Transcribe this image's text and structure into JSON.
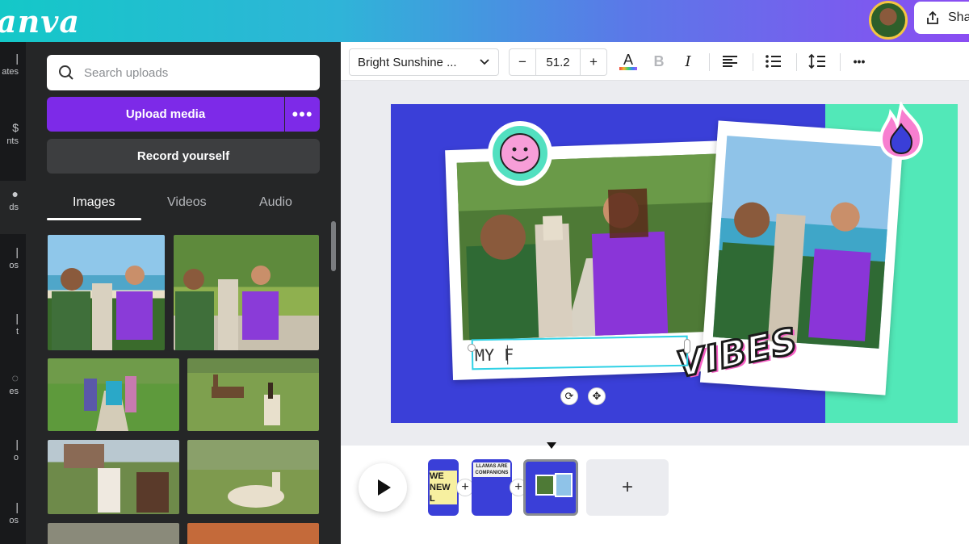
{
  "header": {
    "logo": "anva",
    "share_label": "Sha"
  },
  "rail": {
    "items": [
      {
        "label": "ates",
        "icon": "templates-icon"
      },
      {
        "label": "nts",
        "icon": "elements-icon"
      },
      {
        "label": "ds",
        "icon": "uploads-icon"
      },
      {
        "label": "os",
        "icon": "photos-icon"
      },
      {
        "label": "t",
        "icon": "text-icon"
      },
      {
        "label": "es",
        "icon": "styles-icon"
      },
      {
        "label": "o",
        "icon": "audio-icon"
      },
      {
        "label": "os",
        "icon": "videos-icon"
      }
    ]
  },
  "uploads": {
    "search_placeholder": "Search uploads",
    "upload_label": "Upload media",
    "more_label": "•••",
    "record_label": "Record yourself",
    "tabs": [
      {
        "label": "Images"
      },
      {
        "label": "Videos"
      },
      {
        "label": "Audio"
      }
    ]
  },
  "toolbar": {
    "font_name": "Bright Sunshine ...",
    "font_size": "51.2",
    "minus": "−",
    "plus": "+",
    "text_color_letter": "A",
    "bold": "B",
    "italic": "I",
    "more": "•••"
  },
  "canvas": {
    "sticker_text": "VIBES",
    "text_box_value": "MY F"
  },
  "timeline": {
    "page1_text": "WE NEW L",
    "page2_text": "LLAMAS ARE COMPANIONS",
    "add_label": "+"
  }
}
